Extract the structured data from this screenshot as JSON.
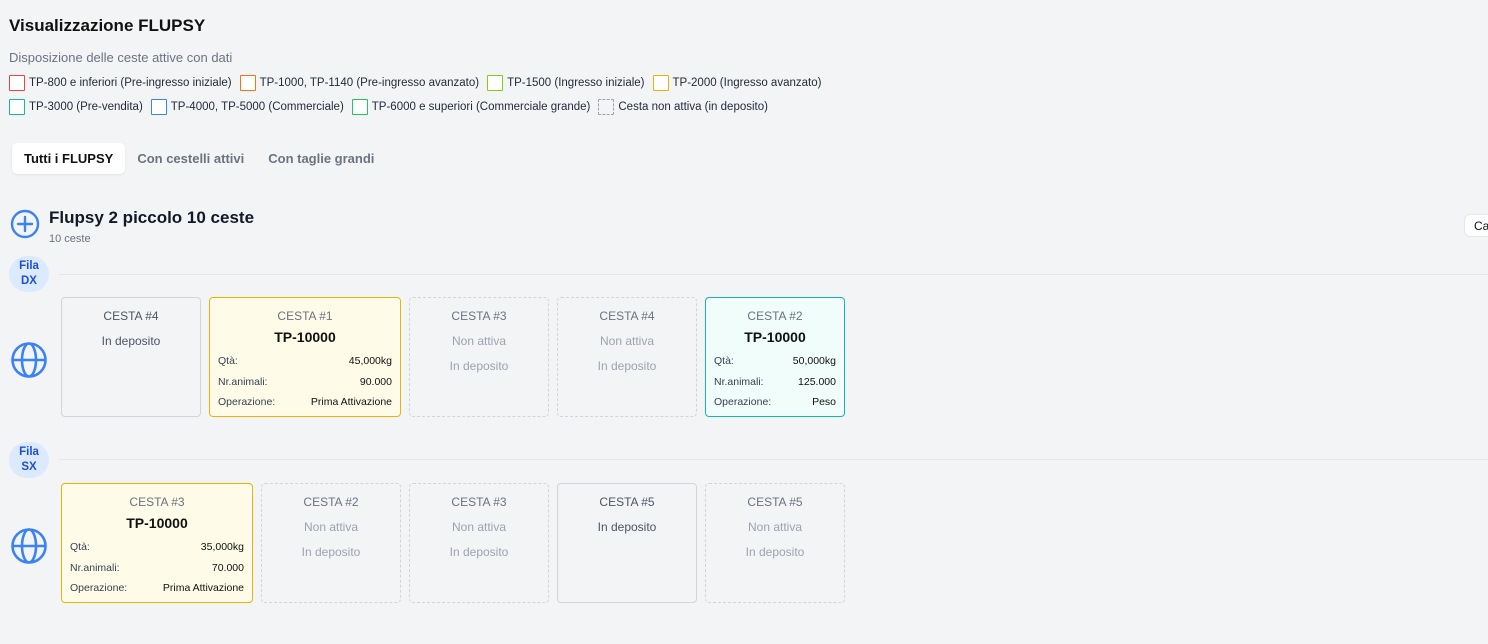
{
  "header": {
    "title": "Visualizzazione FLUPSY",
    "subtitle": "Disposizione delle ceste attive con dati"
  },
  "legend": {
    "row1": [
      {
        "label": "TP-800 e inferiori (Pre-ingresso iniziale)",
        "color": "#ef4444"
      },
      {
        "label": "TP-1000, TP-1140 (Pre-ingresso avanzato)",
        "color": "#f97316"
      },
      {
        "label": "TP-1500 (Ingresso iniziale)",
        "color": "#84cc16"
      },
      {
        "label": "TP-2000 (Ingresso avanzato)",
        "color": "#eab308"
      }
    ],
    "row2": [
      {
        "label": "TP-3000 (Pre-vendita)",
        "color": "#14b8a6"
      },
      {
        "label": "TP-4000, TP-5000 (Commerciale)",
        "color": "#3b82f6"
      },
      {
        "label": "TP-6000 e superiori (Commerciale grande)",
        "color": "#22c55e"
      },
      {
        "label": "Cesta non attiva (in deposito)",
        "color": "#9ca3af"
      }
    ]
  },
  "tabs": [
    "Tutti i FLUPSY",
    "Con cestelli attivi",
    "Con taglie grandi"
  ],
  "flupsy": {
    "name": "Flupsy 2 piccolo 10 ceste",
    "count": "10 ceste",
    "cut_button": "Ca"
  },
  "rows": {
    "dx": {
      "label_line1": "Fila",
      "label_line2": "DX",
      "baskets": [
        {
          "label": "CESTA #4",
          "status": "In deposito"
        },
        {
          "label": "CESTA #1",
          "size": "TP-10000",
          "qta_label": "Qtà:",
          "qta": "45,000kg",
          "animali_label": "Nr.animali:",
          "animali": "90.000",
          "op_label": "Operazione:",
          "op": "Prima Attivazione"
        },
        {
          "label": "CESTA #3",
          "status": "Non attiva",
          "status2": "In deposito"
        },
        {
          "label": "CESTA #4",
          "status": "Non attiva",
          "status2": "In deposito"
        },
        {
          "label": "CESTA #2",
          "size": "TP-10000",
          "qta_label": "Qtà:",
          "qta": "50,000kg",
          "animali_label": "Nr.animali:",
          "animali": "125.000",
          "op_label": "Operazione:",
          "op": "Peso"
        }
      ]
    },
    "sx": {
      "label_line1": "Fila",
      "label_line2": "SX",
      "baskets": [
        {
          "label": "CESTA #3",
          "size": "TP-10000",
          "qta_label": "Qtà:",
          "qta": "35,000kg",
          "animali_label": "Nr.animali:",
          "animali": "70.000",
          "op_label": "Operazione:",
          "op": "Prima Attivazione"
        },
        {
          "label": "CESTA #2",
          "status": "Non attiva",
          "status2": "In deposito"
        },
        {
          "label": "CESTA #3",
          "status": "Non attiva",
          "status2": "In deposito"
        },
        {
          "label": "CESTA #5",
          "status": "In deposito"
        },
        {
          "label": "CESTA #5",
          "status": "Non attiva",
          "status2": "In deposito"
        }
      ]
    }
  }
}
